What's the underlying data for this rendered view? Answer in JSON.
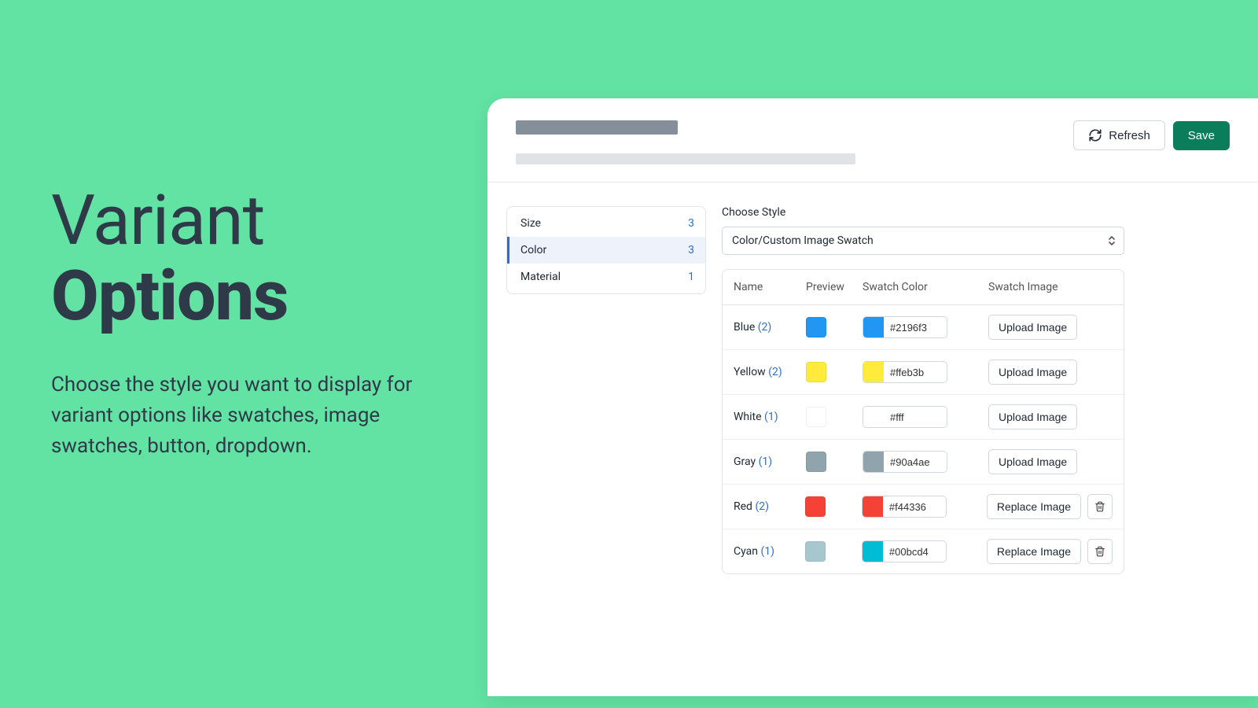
{
  "hero": {
    "title1": "Variant",
    "title2": "Options",
    "desc": "Choose the style you want to display for variant options like swatches, image swatches, button, dropdown."
  },
  "header": {
    "refresh_label": "Refresh",
    "save_label": "Save"
  },
  "sidebar": {
    "items": [
      {
        "label": "Size",
        "count": "3",
        "active": false
      },
      {
        "label": "Color",
        "count": "3",
        "active": true
      },
      {
        "label": "Material",
        "count": "1",
        "active": false
      }
    ]
  },
  "style_selector": {
    "label": "Choose Style",
    "selected": "Color/Custom Image Swatch"
  },
  "table": {
    "headers": {
      "name": "Name",
      "preview": "Preview",
      "swatch": "Swatch Color",
      "image": "Swatch Image"
    },
    "upload_label": "Upload Image",
    "replace_label": "Replace Image",
    "rows": [
      {
        "name": "Blue",
        "count": "(2)",
        "preview_color": "#2196f3",
        "swatch_color": "#2196f3",
        "swatch_hex": "#2196f3",
        "has_image": false
      },
      {
        "name": "Yellow",
        "count": "(2)",
        "preview_color": "#ffeb3b",
        "swatch_color": "#ffeb3b",
        "swatch_hex": "#ffeb3b",
        "has_image": false
      },
      {
        "name": "White",
        "count": "(1)",
        "preview_color": "#ffffff",
        "swatch_color": "#ffffff",
        "swatch_hex": "#fff",
        "has_image": false
      },
      {
        "name": "Gray",
        "count": "(1)",
        "preview_color": "#90a4ae",
        "swatch_color": "#90a4ae",
        "swatch_hex": "#90a4ae",
        "has_image": false
      },
      {
        "name": "Red",
        "count": "(2)",
        "preview_color": "#f44336",
        "swatch_color": "#f44336",
        "swatch_hex": "#f44336",
        "has_image": true
      },
      {
        "name": "Cyan",
        "count": "(1)",
        "preview_color": "#a7c7cf",
        "swatch_color": "#00bcd4",
        "swatch_hex": "#00bcd4",
        "has_image": true
      }
    ]
  }
}
